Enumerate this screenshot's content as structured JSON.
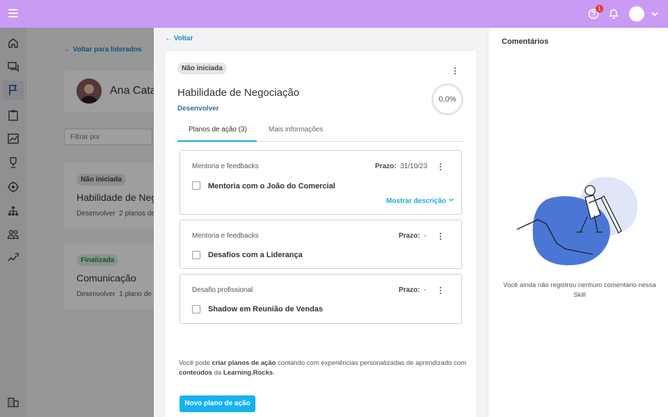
{
  "topbar": {
    "notification_count": "1",
    "icons": [
      "menu-icon",
      "help-icon",
      "bell-icon",
      "avatar",
      "chevron-down-icon"
    ]
  },
  "sidebar": {
    "items": [
      "home-icon",
      "chat-icon",
      "flag-icon",
      "clipboard-icon",
      "chart-icon",
      "trophy-icon",
      "target-icon",
      "org-chart-icon",
      "users-icon",
      "trend-icon",
      "building-icon"
    ]
  },
  "background": {
    "back_label": "Voltar para liderados",
    "profile_name": "Ana Cata",
    "filter_placeholder": "Filtrar por",
    "cards": [
      {
        "status": "Não iniciada",
        "title": "Habilidade de Neg",
        "sub_type": "Desenvolver",
        "sub_count": "2 planos de"
      },
      {
        "status": "Finalizada",
        "title": "Comunicação",
        "sub_type": "Desenvolver",
        "sub_count": "1 plano de a"
      }
    ]
  },
  "drawer": {
    "back_label": "Voltar",
    "status": "Não iniciada",
    "title": "Habilidade de Negociação",
    "subtitle": "Desenvolver",
    "progress": "0,0%",
    "tabs": [
      {
        "label": "Planos de ação (3)",
        "active": true
      },
      {
        "label": "Mais informações",
        "active": false
      }
    ],
    "plans": [
      {
        "category": "Mentoria e feedbacks",
        "deadline_label": "Prazo:",
        "deadline_value": "31/10/23",
        "title": "Mentoria com o João do Comercial",
        "show_description": "Mostrar descrição"
      },
      {
        "category": "Mentoria e feedbacks",
        "deadline_label": "Prazo:",
        "deadline_value": "-",
        "title": "Desafios com a Liderança"
      },
      {
        "category": "Desafio profissional",
        "deadline_label": "Prazo:",
        "deadline_value": "-",
        "title": "Shadow em Reunião de Vendas"
      }
    ],
    "help_text": {
      "p1": "Você pode ",
      "b1": "criar planos de ação",
      "p2": " contando com experiências personalizadas de aprendizado com ",
      "b2": "conteúdos",
      "p3": " da ",
      "b3": "Learning.Rocks",
      "p4": "."
    },
    "new_button": "Novo plano de ação"
  },
  "comments": {
    "title": "Comentários",
    "empty_text": "Você ainda não registrou nenhum comentário nessa Skill"
  },
  "colors": {
    "topbar": "#c99bf5",
    "accent": "#16b2f0",
    "link": "#1e88c8",
    "badge": "#e53935",
    "illustration_blue": "#4a77d6",
    "illustration_light": "#dfe6f8"
  }
}
